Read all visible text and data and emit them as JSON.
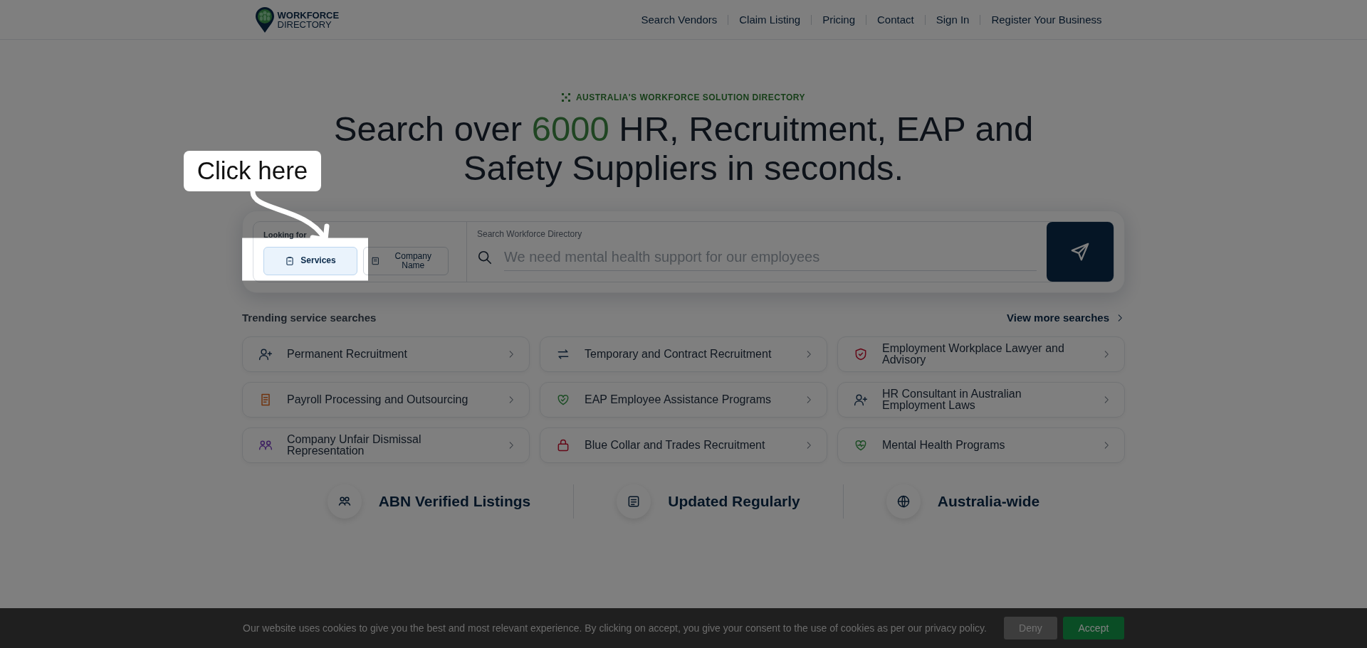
{
  "nav": {
    "logo": {
      "line_1": "WORKFORCE",
      "line_2": "DIRECTORY"
    },
    "links": [
      "Search Vendors",
      "Claim Listing",
      "Pricing",
      "Contact",
      "Sign In",
      "Register Your Business"
    ]
  },
  "hero": {
    "eyebrow": "AUSTRALIA'S WORKFORCE SOLUTION DIRECTORY",
    "heading": [
      {
        "text": "Search over ",
        "accent": false
      },
      {
        "text": "6000",
        "accent": true
      },
      {
        "text": " HR, Recruitment, EAP and Safety Suppliers in seconds.",
        "accent": false
      }
    ]
  },
  "search": {
    "looking_for_label": "Looking for",
    "options": [
      {
        "label": "Services",
        "selected": true,
        "highlighted": true
      },
      {
        "label": "Company Name",
        "selected": false,
        "highlighted": false
      }
    ],
    "field_label": "Search Workforce Directory",
    "placeholder": "We need mental health support for our employees"
  },
  "trending": {
    "title": "Trending service searches",
    "more_link": "View more searches",
    "items": [
      {
        "label": "Permanent Recruitment"
      },
      {
        "label": "Temporary and Contract Recruitment"
      },
      {
        "label": "Employment Workplace Lawyer and Advisory"
      },
      {
        "label": "Payroll Processing and Outsourcing"
      },
      {
        "label": "EAP Employee Assistance Programs"
      },
      {
        "label": "HR Consultant in Australian Employment Laws"
      },
      {
        "label": "Company Unfair Dismissal Representation"
      },
      {
        "label": "Blue Collar and Trades Recruitment"
      },
      {
        "label": "Mental Health Programs"
      }
    ]
  },
  "stats": [
    "ABN Verified Listings",
    "Updated Regularly",
    "Australia-wide"
  ],
  "cookie": {
    "message": "Our website uses cookies to give you the best and most relevant experience. By clicking on accept, you give your consent to the use of cookies as per our privacy policy.",
    "buttons": [
      {
        "label": "Deny",
        "kind": "secondary"
      },
      {
        "label": "Accept",
        "kind": "primary"
      }
    ]
  },
  "tutorial": {
    "callout": "Click here"
  }
}
